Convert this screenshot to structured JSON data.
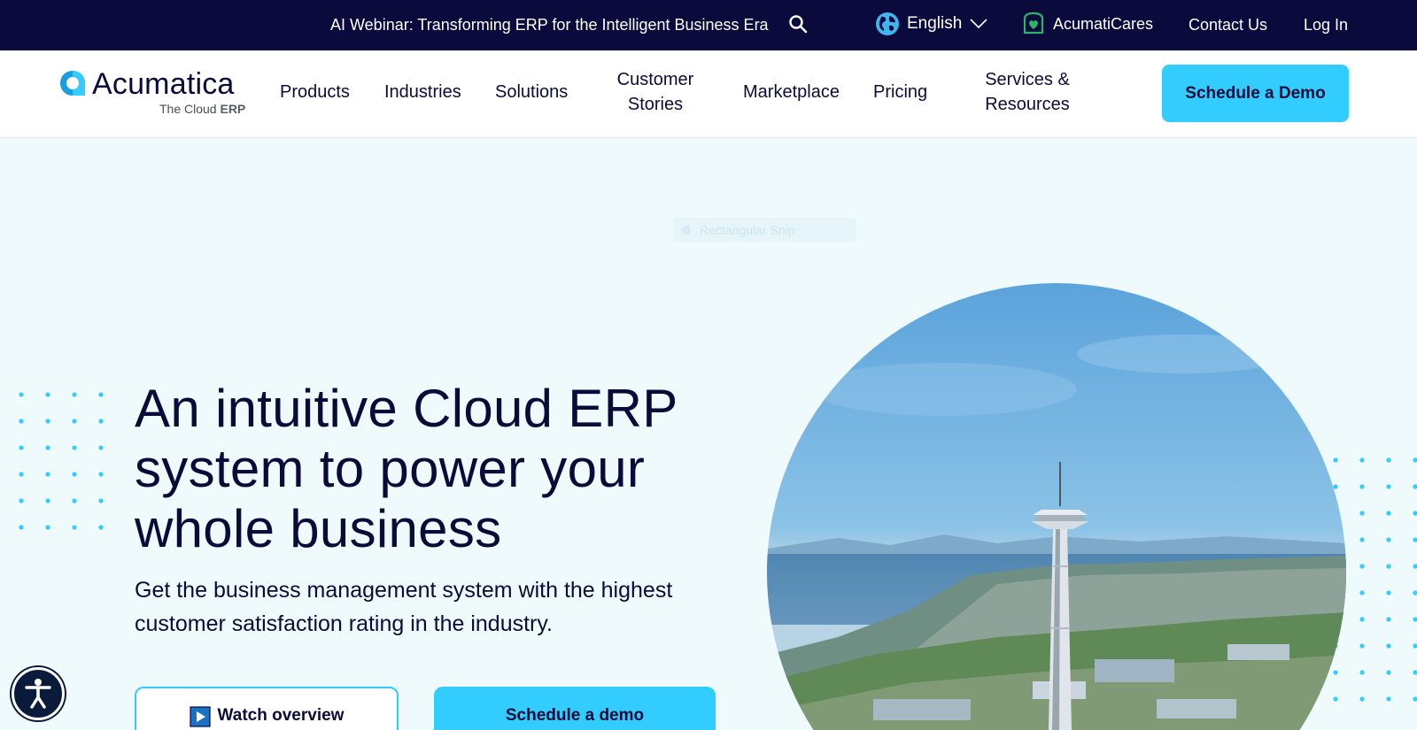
{
  "topbar": {
    "promo": "AI Webinar: Transforming ERP for the Intelligent Business Era",
    "language": "English",
    "acumaticares": "AcumatiCares",
    "contact": "Contact Us",
    "login": "Log In"
  },
  "logo": {
    "name": "Acumatica",
    "tagline_light": "The Cloud ",
    "tagline_bold": "ERP"
  },
  "nav": {
    "products": "Products",
    "industries": "Industries",
    "solutions": "Solutions",
    "customer_stories_line1": "Customer",
    "customer_stories_line2": "Stories",
    "marketplace": "Marketplace",
    "pricing": "Pricing",
    "services_line1": "Services &",
    "services_line2": "Resources",
    "cta": "Schedule a Demo"
  },
  "hero": {
    "ghost_label": "Rectangular Snip",
    "headline_line1": "An intuitive Cloud ERP",
    "headline_line2": "system to power your",
    "headline_line3": "whole business",
    "sub_line1": "Get the business management system with the highest",
    "sub_line2": "customer satisfaction rating in the industry.",
    "watch_label": "Watch overview",
    "demo_label": "Schedule a demo"
  },
  "colors": {
    "topbar_bg": "#0a0a3c",
    "accent": "#33ccff",
    "hero_bg": "#effafd",
    "text": "#0b0b3a"
  },
  "icons": {
    "search": "search-icon",
    "globe": "globe-icon",
    "chevron": "chevron-down-icon",
    "cares": "acumaticares-icon",
    "play": "play-icon",
    "accessibility": "accessibility-icon"
  }
}
